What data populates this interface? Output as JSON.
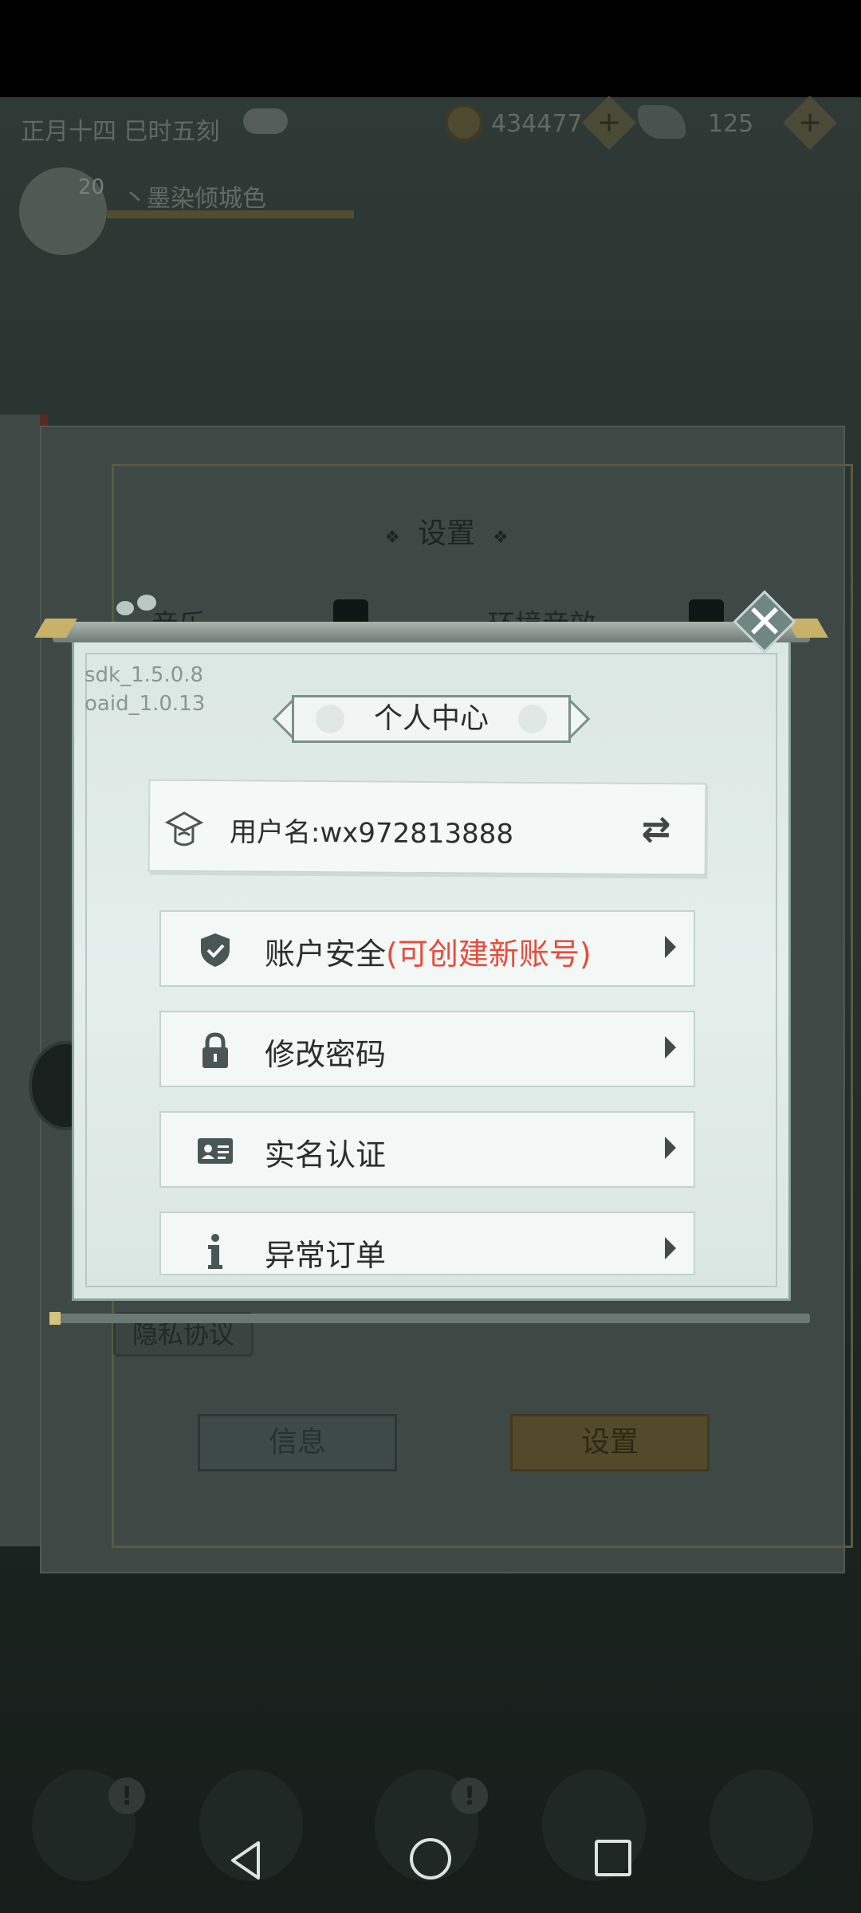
{
  "hud": {
    "date": "正月十四 巳时五刻",
    "coins": "434477",
    "gems": "125"
  },
  "player": {
    "level": "20",
    "name": "丶墨染倾城色"
  },
  "settings_book": {
    "title": "设置",
    "music_label": "音乐",
    "ambient_label": "环境音效",
    "privacy_label": "隐私协议",
    "info_tab": "信息",
    "settings_tab": "设置"
  },
  "dialog": {
    "sdk_version": "sdk_1.5.0.8",
    "oaid_version": "oaid_1.0.13",
    "title": "个人中心",
    "username_label": "用户名:",
    "username_value": "wx972813888",
    "menu": [
      {
        "label": "账户安全",
        "note": "(可创建新账号)",
        "icon": "shield-check-icon"
      },
      {
        "label": "修改密码",
        "icon": "lock-icon"
      },
      {
        "label": "实名认证",
        "icon": "id-card-icon"
      },
      {
        "label": "异常订单",
        "icon": "info-icon"
      }
    ]
  },
  "colors": {
    "accent_red": "#e74c3c",
    "dialog_bg": "#e0ebe8",
    "icon_color": "#4a5654"
  }
}
